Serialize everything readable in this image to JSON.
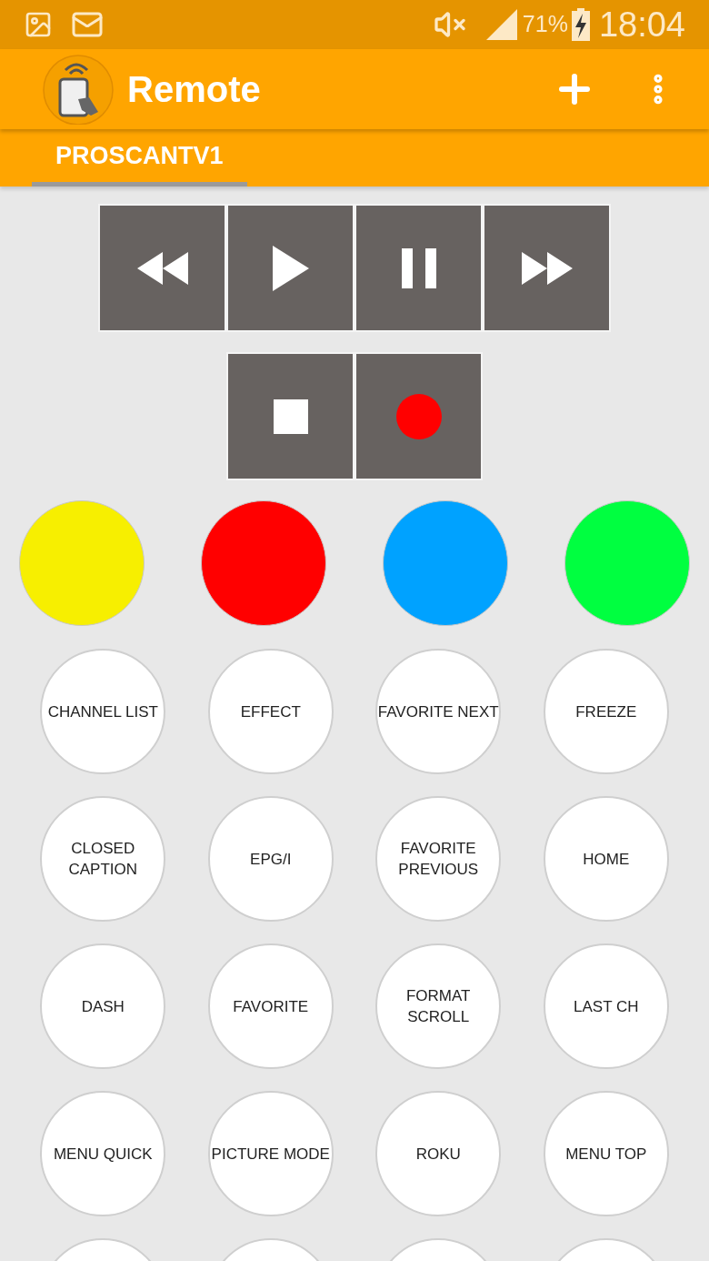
{
  "status_bar": {
    "battery": "71%",
    "time": "18:04"
  },
  "app_bar": {
    "title": "Remote"
  },
  "tabs": [
    {
      "label": "PROSCANTV1",
      "selected": true
    }
  ],
  "media_buttons": [
    {
      "kind": "rewind"
    },
    {
      "kind": "play"
    },
    {
      "kind": "pause"
    },
    {
      "kind": "fast_forward"
    }
  ],
  "media_buttons_row2": [
    {
      "kind": "stop"
    },
    {
      "kind": "record"
    }
  ],
  "color_buttons": [
    {
      "color": "#f7ef00"
    },
    {
      "color": "#ff0000"
    },
    {
      "color": "#00a2ff"
    },
    {
      "color": "#00ff40"
    }
  ],
  "buttons": [
    {
      "kind": "label",
      "label": "CHANNEL LIST"
    },
    {
      "kind": "label",
      "label": "EFFECT"
    },
    {
      "kind": "label",
      "label": "FAVORITE NEXT"
    },
    {
      "kind": "label",
      "label": "FREEZE"
    },
    {
      "kind": "label",
      "label": "CLOSED\nCAPTION"
    },
    {
      "kind": "label",
      "label": "EPG/I"
    },
    {
      "kind": "label",
      "label": "FAVORITE\nPREVIOUS"
    },
    {
      "kind": "label",
      "label": "HOME"
    },
    {
      "kind": "label",
      "label": "DASH"
    },
    {
      "kind": "label",
      "label": "FAVORITE"
    },
    {
      "kind": "label",
      "label": "FORMAT\nSCROLL"
    },
    {
      "kind": "label",
      "label": "LAST CH"
    },
    {
      "kind": "label",
      "label": "MENU QUICK"
    },
    {
      "kind": "label",
      "label": "PICTURE MODE"
    },
    {
      "kind": "label",
      "label": "ROKU"
    },
    {
      "kind": "label",
      "label": "MENU TOP"
    },
    {
      "kind": "cut"
    },
    {
      "kind": "cut"
    },
    {
      "kind": "cut"
    },
    {
      "kind": "cut"
    }
  ]
}
